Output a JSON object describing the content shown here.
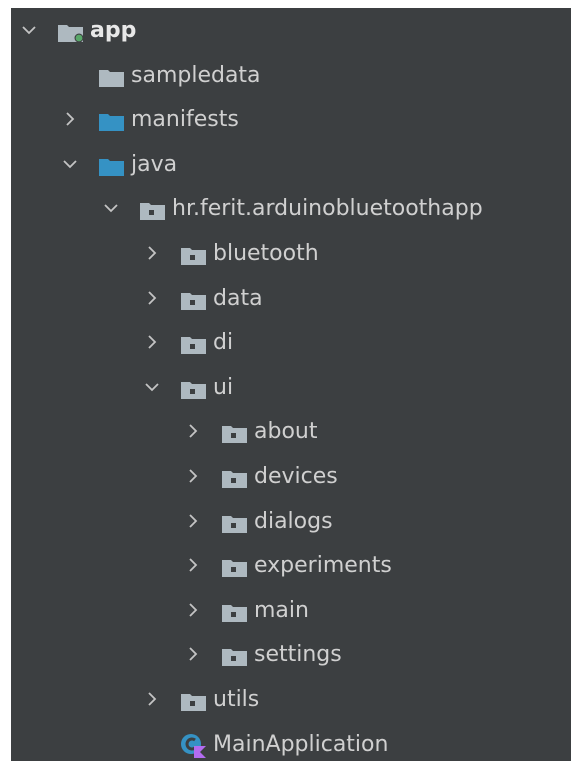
{
  "tree": [
    {
      "label": "app",
      "depth": 0,
      "expand": "expanded",
      "icon": "module-folder-icon",
      "bold": true
    },
    {
      "label": "sampledata",
      "depth": 1,
      "expand": "none",
      "icon": "folder-icon",
      "bold": false
    },
    {
      "label": "manifests",
      "depth": 1,
      "expand": "collapsed",
      "icon": "source-folder-icon",
      "bold": false
    },
    {
      "label": "java",
      "depth": 1,
      "expand": "expanded",
      "icon": "source-folder-icon",
      "bold": false
    },
    {
      "label": "hr.ferit.arduinobluetoothapp",
      "depth": 2,
      "expand": "expanded",
      "icon": "package-icon",
      "bold": false
    },
    {
      "label": "bluetooth",
      "depth": 3,
      "expand": "collapsed",
      "icon": "package-icon",
      "bold": false
    },
    {
      "label": "data",
      "depth": 3,
      "expand": "collapsed",
      "icon": "package-icon",
      "bold": false
    },
    {
      "label": "di",
      "depth": 3,
      "expand": "collapsed",
      "icon": "package-icon",
      "bold": false
    },
    {
      "label": "ui",
      "depth": 3,
      "expand": "expanded",
      "icon": "package-icon",
      "bold": false
    },
    {
      "label": "about",
      "depth": 4,
      "expand": "collapsed",
      "icon": "package-icon",
      "bold": false
    },
    {
      "label": "devices",
      "depth": 4,
      "expand": "collapsed",
      "icon": "package-icon",
      "bold": false
    },
    {
      "label": "dialogs",
      "depth": 4,
      "expand": "collapsed",
      "icon": "package-icon",
      "bold": false
    },
    {
      "label": "experiments",
      "depth": 4,
      "expand": "collapsed",
      "icon": "package-icon",
      "bold": false
    },
    {
      "label": "main",
      "depth": 4,
      "expand": "collapsed",
      "icon": "package-icon",
      "bold": false
    },
    {
      "label": "settings",
      "depth": 4,
      "expand": "collapsed",
      "icon": "package-icon",
      "bold": false
    },
    {
      "label": "utils",
      "depth": 3,
      "expand": "collapsed",
      "icon": "package-icon",
      "bold": false
    },
    {
      "label": "MainApplication",
      "depth": 3,
      "expand": "none",
      "icon": "kotlin-class-icon",
      "bold": false
    }
  ],
  "colors": {
    "background": "#3c3f41",
    "text": "#d0d0d0",
    "folder_gray": "#aeb9c0",
    "folder_blue": "#3592c4",
    "module_dot": "#59a869",
    "kotlin_purple": "#b36cf0",
    "class_blue": "#3592c4"
  }
}
